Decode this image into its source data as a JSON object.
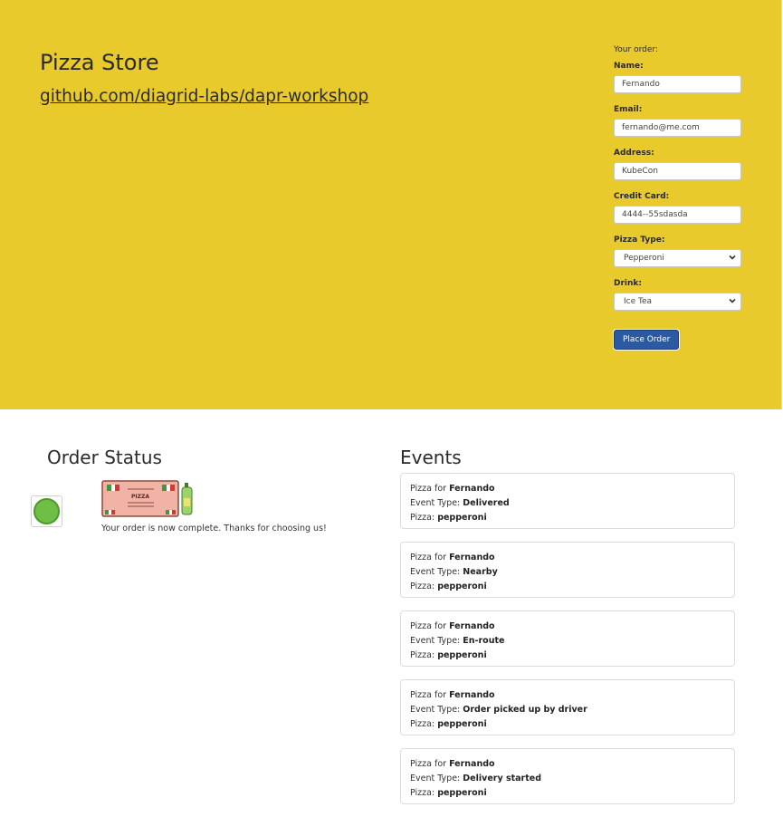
{
  "header": {
    "title": "Pizza Store",
    "repo_link": "github.com/diagrid-labs/dapr-workshop"
  },
  "order_form": {
    "heading": "Your order:",
    "name_label": "Name:",
    "name_value": "Fernando",
    "email_label": "Email:",
    "email_value": "fernando@me.com",
    "address_label": "Address:",
    "address_value": "KubeCon",
    "card_label": "Credit Card:",
    "card_value": "4444--55sdasda",
    "pizza_label": "Pizza Type:",
    "pizza_value": "Pepperoni",
    "drink_label": "Drink:",
    "drink_value": "Ice Tea",
    "submit_label": "Place Order"
  },
  "order_status": {
    "title": "Order Status",
    "box_text": "PIZZA",
    "message": "Your order is now complete. Thanks for choosing us!",
    "status_color": "#6fbe45"
  },
  "events": {
    "title": "Events",
    "pizza_for_label": "Pizza for ",
    "event_type_label": "Event Type: ",
    "pizza_label": "Pizza: ",
    "items": [
      {
        "customer": "Fernando",
        "event_type": "Delivered",
        "pizza": "pepperoni"
      },
      {
        "customer": "Fernando",
        "event_type": "Nearby",
        "pizza": "pepperoni"
      },
      {
        "customer": "Fernando",
        "event_type": "En-route",
        "pizza": "pepperoni"
      },
      {
        "customer": "Fernando",
        "event_type": "Order picked up by driver",
        "pizza": "pepperoni"
      },
      {
        "customer": "Fernando",
        "event_type": "Delivery started",
        "pizza": "pepperoni"
      }
    ]
  },
  "colors": {
    "hero_bg": "#e9ca2c",
    "button_bg": "#2b5aa3"
  }
}
